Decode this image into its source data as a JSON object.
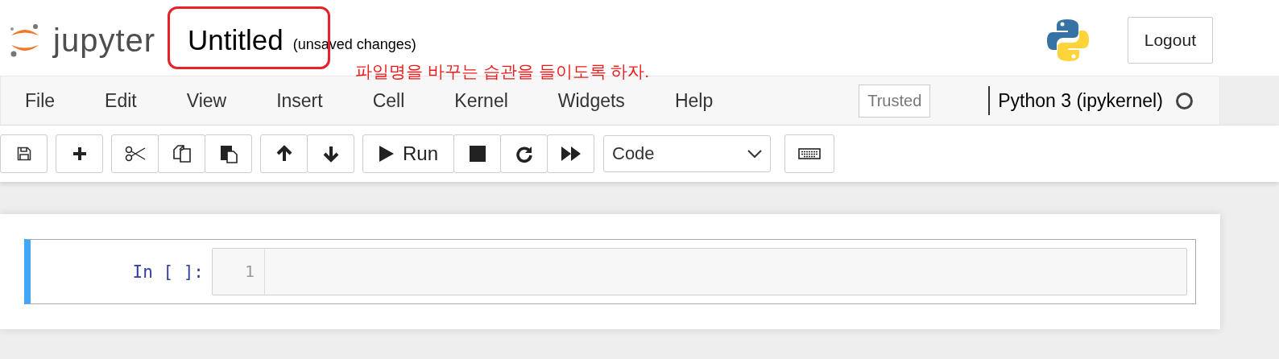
{
  "header": {
    "logo_text": "jupyter",
    "notebook_name": "Untitled",
    "save_status": "(unsaved changes)",
    "logout": "Logout"
  },
  "annotation": {
    "note": "파일명을 바꾸는 습관을 들이도록 하자."
  },
  "menu": [
    "File",
    "Edit",
    "View",
    "Insert",
    "Cell",
    "Kernel",
    "Widgets",
    "Help"
  ],
  "trusted": "Trusted",
  "kernel": {
    "name": "Python 3 (ipykernel)",
    "busy": false
  },
  "toolbar": [
    [
      {
        "kind": "save"
      }
    ],
    [
      {
        "kind": "insert"
      }
    ],
    [
      {
        "kind": "cut"
      },
      {
        "kind": "copy"
      },
      {
        "kind": "paste"
      }
    ],
    [
      {
        "kind": "up"
      },
      {
        "kind": "down"
      }
    ],
    [
      {
        "kind": "run",
        "label": "Run"
      },
      {
        "kind": "stop"
      },
      {
        "kind": "restart"
      },
      {
        "kind": "run-all"
      }
    ]
  ],
  "cell_type": "Code",
  "cell": {
    "prompt": "In [ ]:",
    "line_number": "1",
    "selected": true
  }
}
